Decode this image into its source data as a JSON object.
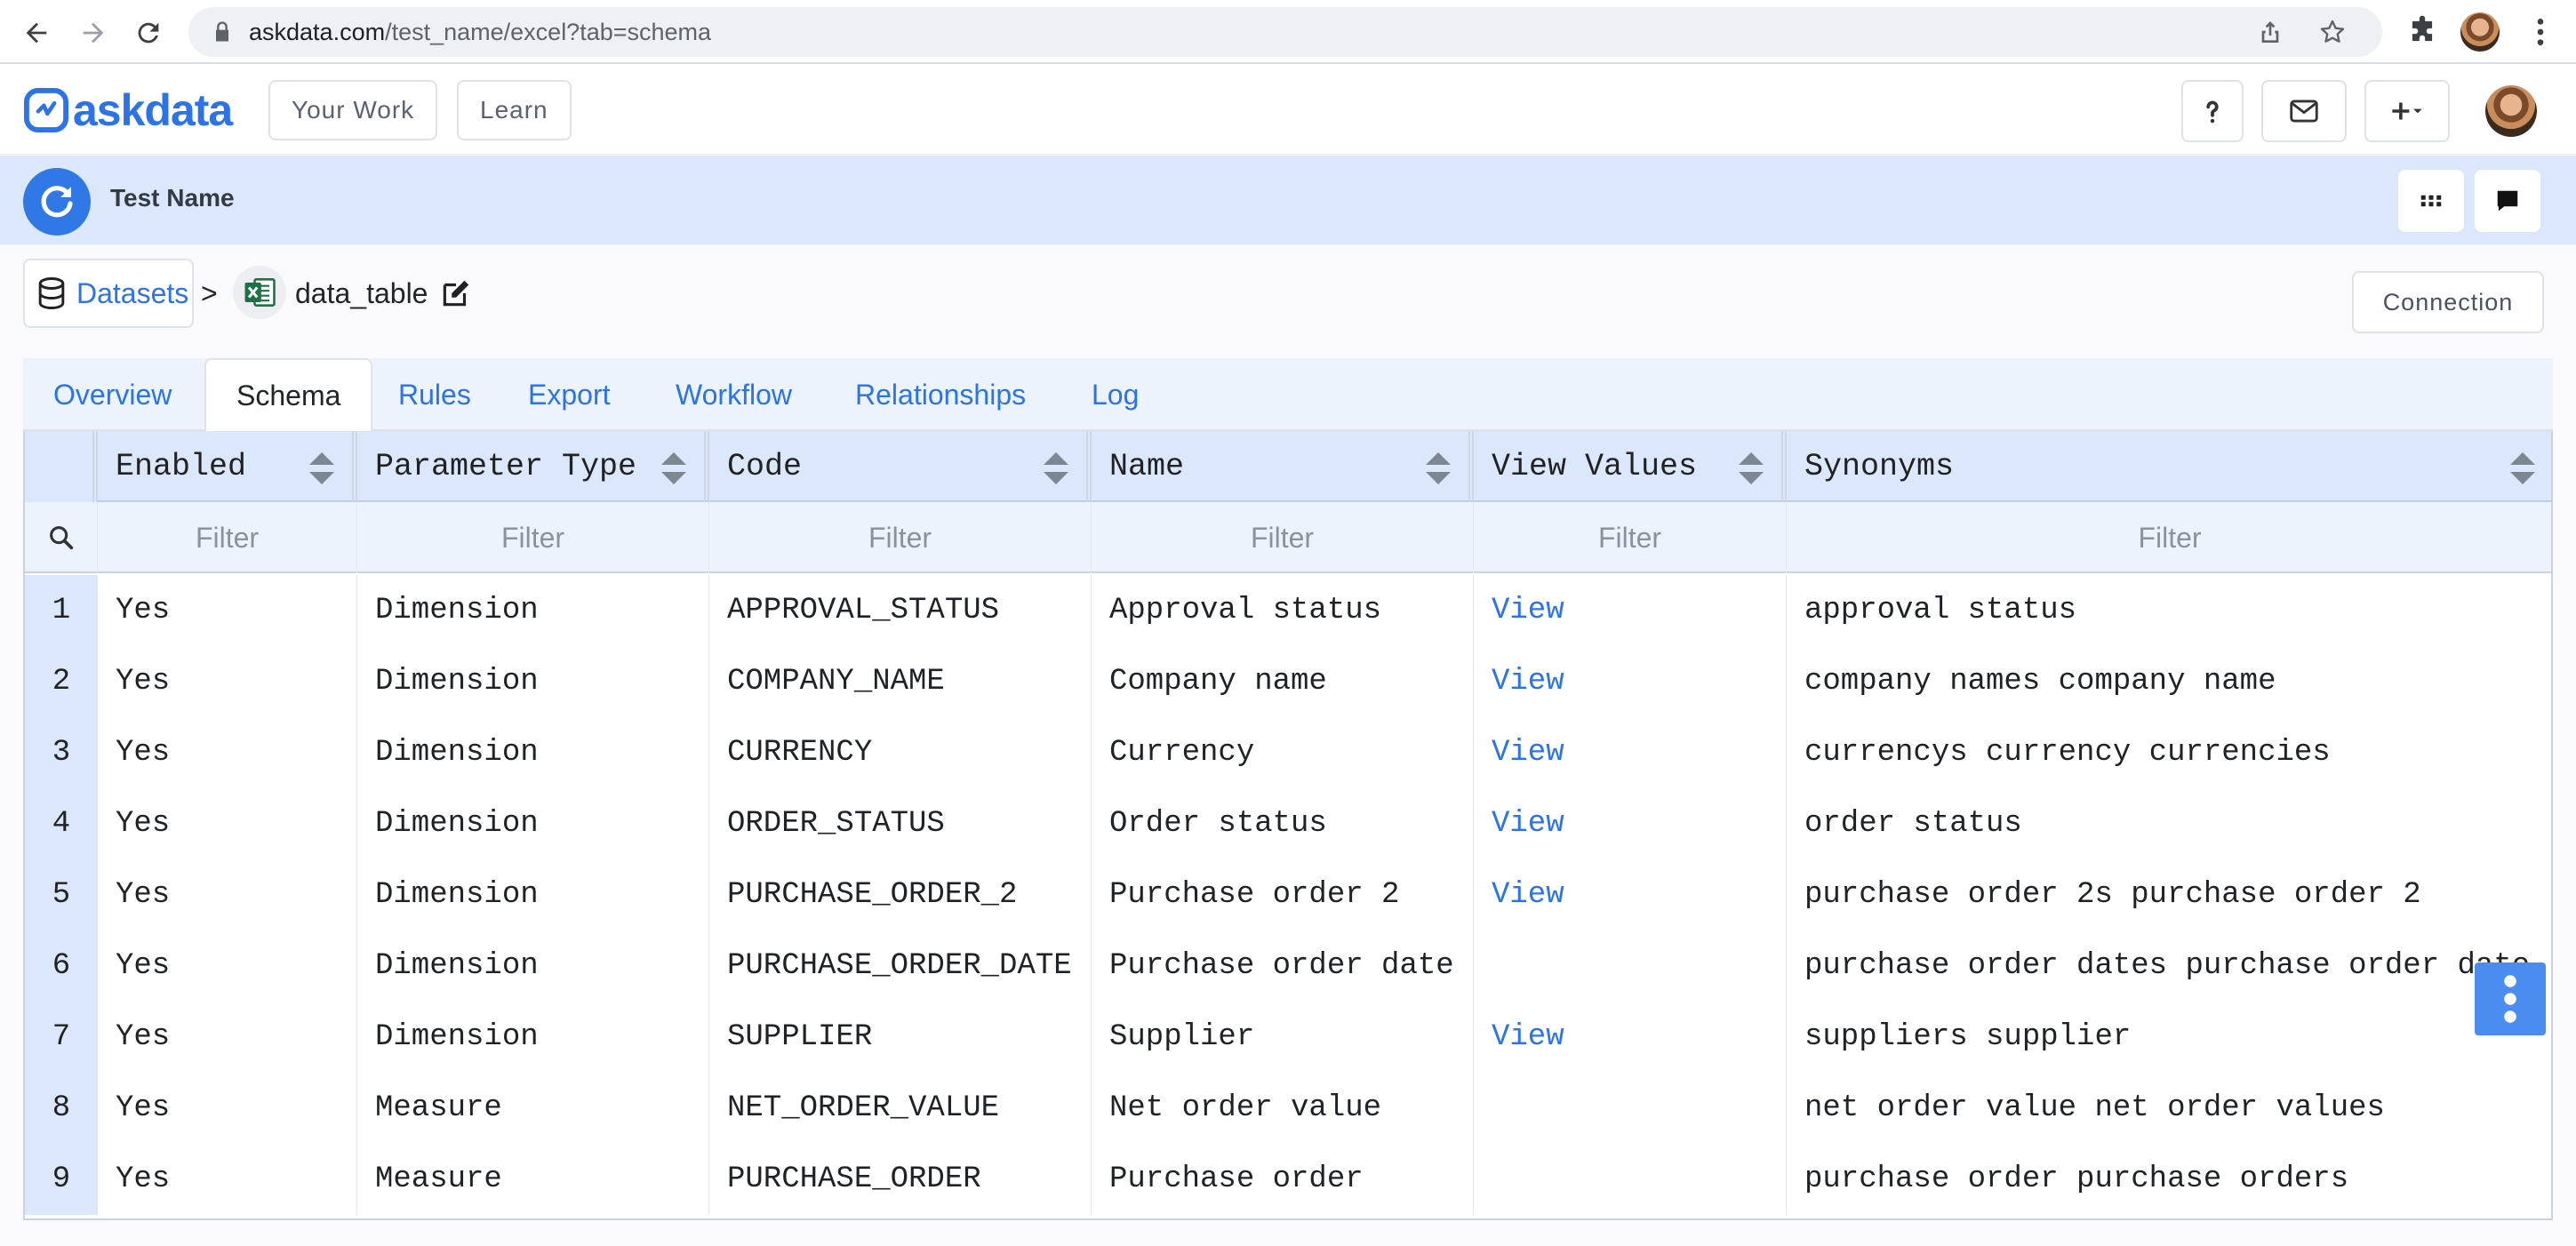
{
  "browser": {
    "url_host": "askdata.com",
    "url_path": "/test_name/excel?tab=schema"
  },
  "app": {
    "logo_text": "askdata",
    "nav": [
      "Your Work",
      "Learn"
    ]
  },
  "project": {
    "name": "Test Name"
  },
  "breadcrumb": {
    "datasets_label": "Datasets",
    "separator": ">",
    "table_name": "data_table",
    "connection_label": "Connection"
  },
  "tabs": [
    "Overview",
    "Schema",
    "Rules",
    "Export",
    "Workflow",
    "Relationships",
    "Log"
  ],
  "active_tab": "Schema",
  "grid": {
    "columns": [
      "Enabled",
      "Parameter Type",
      "Code",
      "Name",
      "View Values",
      "Synonyms"
    ],
    "filter_placeholder": "Filter",
    "rows": [
      {
        "n": "1",
        "enabled": "Yes",
        "type": "Dimension",
        "code": "APPROVAL_STATUS",
        "name": "Approval status",
        "view": "View",
        "synonyms": "approval status"
      },
      {
        "n": "2",
        "enabled": "Yes",
        "type": "Dimension",
        "code": "COMPANY_NAME",
        "name": "Company name",
        "view": "View",
        "synonyms": "company names company name"
      },
      {
        "n": "3",
        "enabled": "Yes",
        "type": "Dimension",
        "code": "CURRENCY",
        "name": "Currency",
        "view": "View",
        "synonyms": "currencys currency currencies"
      },
      {
        "n": "4",
        "enabled": "Yes",
        "type": "Dimension",
        "code": "ORDER_STATUS",
        "name": "Order status",
        "view": "View",
        "synonyms": "order status"
      },
      {
        "n": "5",
        "enabled": "Yes",
        "type": "Dimension",
        "code": "PURCHASE_ORDER_2",
        "name": "Purchase order 2",
        "view": "View",
        "synonyms": "purchase order 2s purchase order 2"
      },
      {
        "n": "6",
        "enabled": "Yes",
        "type": "Dimension",
        "code": "PURCHASE_ORDER_DATE",
        "name": "Purchase order date",
        "view": "",
        "synonyms": "purchase order dates purchase order date"
      },
      {
        "n": "7",
        "enabled": "Yes",
        "type": "Dimension",
        "code": "SUPPLIER",
        "name": "Supplier",
        "view": "View",
        "synonyms": "suppliers supplier"
      },
      {
        "n": "8",
        "enabled": "Yes",
        "type": "Measure",
        "code": "NET_ORDER_VALUE",
        "name": "Net order value",
        "view": "",
        "synonyms": "net order value net order values"
      },
      {
        "n": "9",
        "enabled": "Yes",
        "type": "Measure",
        "code": "PURCHASE_ORDER",
        "name": "Purchase order",
        "view": "",
        "synonyms": "purchase order purchase orders"
      }
    ]
  },
  "colors": {
    "accent": "#2b73e6",
    "header_bg": "#dbe8fb",
    "filter_bg": "#edf3fd"
  },
  "icons": {
    "back": "arrow-left-icon",
    "forward": "arrow-right-icon",
    "reload": "reload-icon",
    "lock": "lock-icon",
    "share": "share-icon",
    "star": "star-icon",
    "extensions": "puzzle-icon",
    "help": "question-icon",
    "mail": "mail-icon",
    "add": "plus-icon",
    "apps": "grid-icon",
    "chat": "chat-icon",
    "database": "database-icon",
    "excel": "excel-icon",
    "edit": "edit-icon",
    "search": "search-icon",
    "more": "kebab-icon"
  }
}
